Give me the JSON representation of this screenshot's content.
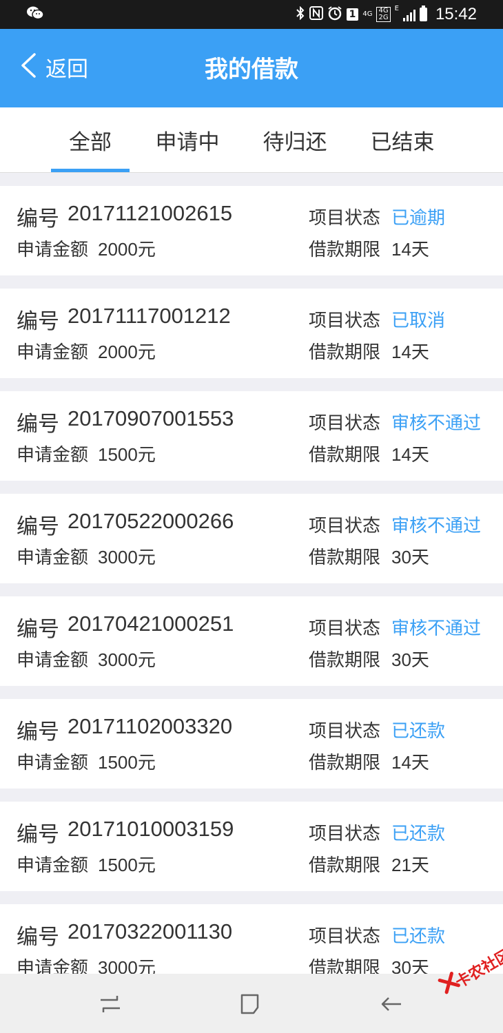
{
  "status_bar": {
    "time": "15:42",
    "sim_badge": "1",
    "network_a": "4G",
    "network_b_top": "4G",
    "network_b_bottom": "2G",
    "network_e": "E"
  },
  "header": {
    "back_label": "返回",
    "title": "我的借款"
  },
  "tabs": [
    {
      "label": "全部",
      "active": true
    },
    {
      "label": "申请中",
      "active": false
    },
    {
      "label": "待归还",
      "active": false
    },
    {
      "label": "已结束",
      "active": false
    }
  ],
  "labels": {
    "id": "编号",
    "amount": "申请金额",
    "status": "项目状态",
    "term": "借款期限"
  },
  "loans": [
    {
      "id": "20171121002615",
      "amount": "2000元",
      "status": "已逾期",
      "term": "14天"
    },
    {
      "id": "20171117001212",
      "amount": "2000元",
      "status": "已取消",
      "term": "14天"
    },
    {
      "id": "20170907001553",
      "amount": "1500元",
      "status": "审核不通过",
      "term": "14天"
    },
    {
      "id": "20170522000266",
      "amount": "3000元",
      "status": "审核不通过",
      "term": "30天"
    },
    {
      "id": "20170421000251",
      "amount": "3000元",
      "status": "审核不通过",
      "term": "30天"
    },
    {
      "id": "20171102003320",
      "amount": "1500元",
      "status": "已还款",
      "term": "14天"
    },
    {
      "id": "20171010003159",
      "amount": "1500元",
      "status": "已还款",
      "term": "21天"
    },
    {
      "id": "20170322001130",
      "amount": "3000元",
      "status": "已还款",
      "term": "30天"
    }
  ],
  "watermark": "卡农社区",
  "colors": {
    "accent": "#3ba0f5",
    "status_bar": "#1a1a1a",
    "page_bg": "#efeff4",
    "watermark": "#e02020"
  },
  "icons": {
    "back": "chevron-left-icon",
    "wechat": "wechat-icon",
    "bluetooth": "bluetooth-icon",
    "nfc": "nfc-icon",
    "alarm": "alarm-icon",
    "nav_recent": "recent-apps-icon",
    "nav_home": "home-icon",
    "nav_back": "back-arrow-icon"
  }
}
